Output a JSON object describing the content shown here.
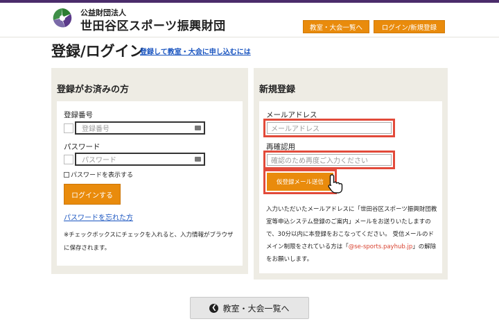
{
  "header": {
    "org_sub": "公益財団法人",
    "org_name": "世田谷区スポーツ振興財団",
    "nav_classes": "教室・大会一覧へ",
    "nav_login": "ログイン/新規登録"
  },
  "page": {
    "title": "登録/ログイン",
    "help_link": "登録して教室・大会に申し込むには"
  },
  "login_panel": {
    "heading": "登録がお済みの方",
    "id_label": "登録番号",
    "id_placeholder": "登録番号",
    "pw_label": "パスワード",
    "pw_placeholder": "パスワード",
    "show_pw": "パスワードを表示する",
    "login_button": "ログインする",
    "forgot": "パスワードを忘れた方",
    "note": "※チェックボックスにチェックを入れると、入力情報がブラウザに保存されます。"
  },
  "register_panel": {
    "heading": "新規登録",
    "email_label": "メールアドレス",
    "email_placeholder": "メールアドレス",
    "confirm_label": "再確認用",
    "confirm_placeholder": "確認のため再度ご入力ください",
    "send_button": "仮登録メール送信",
    "info_before": "入力いただいたメールアドレスに「世田谷区スポーツ振興財団教室等申込システム登録のご案内」メールをお送りいたしますので、30分以内に本登録をおこなってください。 受信メールのドメイン制限をされている方は「",
    "info_domain": "@se-sports.payhub.jp",
    "info_after": "」の解除をお願いします。"
  },
  "footer": {
    "back_button": "教室・大会一覧へ"
  },
  "colors": {
    "accent_orange": "#e98b0c",
    "highlight_red": "#e24a3a",
    "top_bar_purple": "#4b2c6b",
    "link_blue": "#1a55c0"
  }
}
